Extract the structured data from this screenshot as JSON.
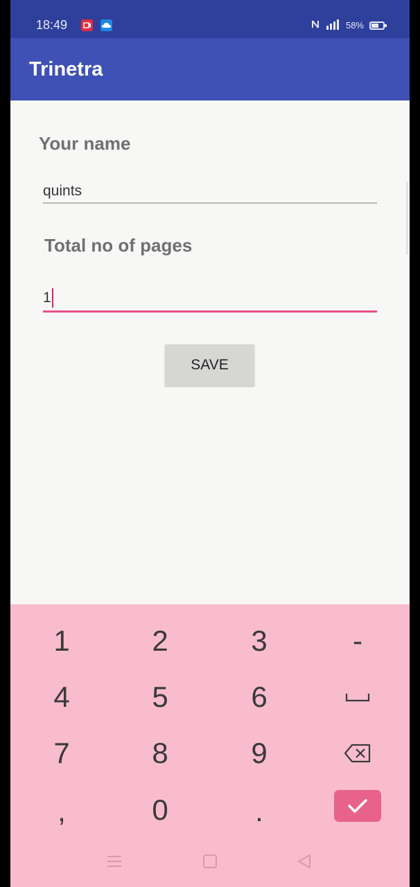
{
  "status_bar": {
    "time": "18:49",
    "battery_percent": "58%",
    "icons": [
      "video-notification-icon",
      "cloud-notification-icon",
      "nfc-icon",
      "signal-icon",
      "battery-icon"
    ]
  },
  "app_bar": {
    "title": "Trinetra"
  },
  "form": {
    "name_label": "Your name",
    "name_value": "quints",
    "pages_label": "Total no of pages",
    "pages_value": "1",
    "save_label": "SAVE"
  },
  "keyboard": {
    "keys": [
      "1",
      "2",
      "3",
      "-",
      "4",
      "5",
      "6",
      "7",
      "8",
      "9",
      ",",
      "0",
      "."
    ],
    "accent_color": "#e8638b",
    "background_color": "#f8bcce"
  },
  "colors": {
    "primary": "#3f51b5",
    "primary_dark": "#2f3f9c",
    "accent": "#e91e63"
  }
}
